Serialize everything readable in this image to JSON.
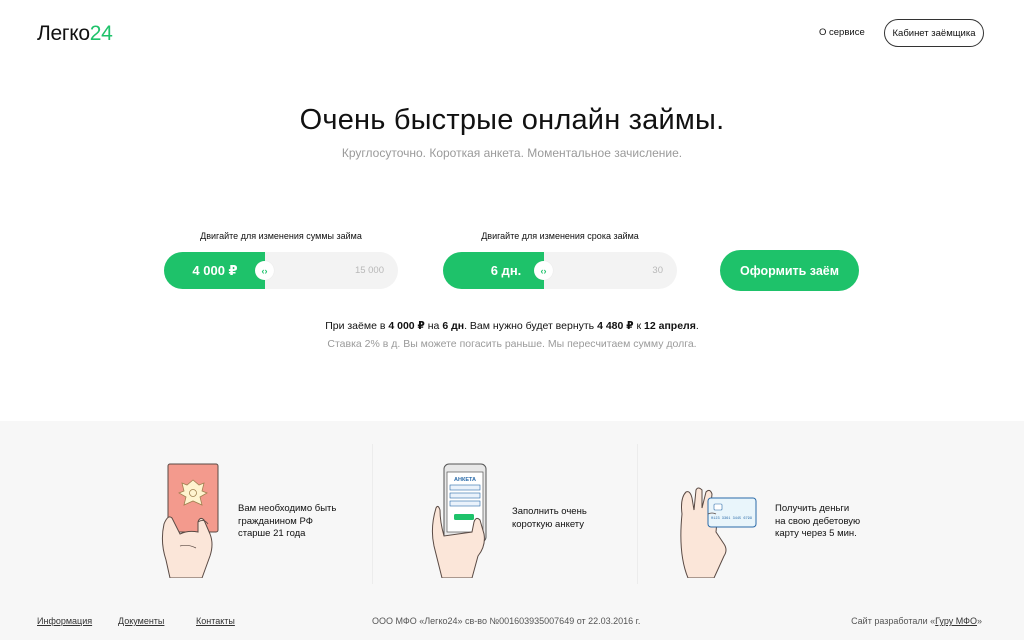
{
  "header": {
    "logo_text": "Легко",
    "logo_num": "24",
    "nav_about": "О сервисе",
    "cabinet_button": "Кабинет заёмщика"
  },
  "hero": {
    "title": "Очень быстрые онлайн займы.",
    "subtitle": "Круглосуточно. Короткая анкета. Моментальное зачисление."
  },
  "amount_slider": {
    "caption": "Двигайте для изменения суммы займа",
    "value_label": "4 000 ₽",
    "max_label": "15 000",
    "value": 4000,
    "max": 15000
  },
  "term_slider": {
    "caption": "Двигайте для изменения срока займа",
    "value_label": "6 дн.",
    "max_label": "30",
    "value": 6,
    "max": 30
  },
  "handle_glyph": "‹›",
  "apply_button": "Оформить заём",
  "summary": {
    "p1": "При заёме в ",
    "amount": "4 000 ₽",
    "p2": " на ",
    "days": "6 дн",
    "p3": ". Вам нужно будет вернуть ",
    "total": "4 480 ₽",
    "p4": " к ",
    "date": "12 апреля",
    "p5": ".",
    "note": "Ставка 2% в д. Вы можете погасить раньше. Мы пересчитаем сумму долга."
  },
  "steps": [
    {
      "icon": "passport-hand-icon",
      "text": [
        "Вам необходимо быть",
        "гражданином РФ",
        "старше 21 года"
      ]
    },
    {
      "icon": "phone-form-icon",
      "phone_label": "АНКЕТА",
      "text": [
        "Заполнить очень",
        "короткую анкету"
      ]
    },
    {
      "icon": "card-hand-icon",
      "card_number": "0123 3361 3445 6799",
      "text": [
        "Получить деньги",
        "на свою дебетовую",
        "карту через 5 мин."
      ]
    }
  ],
  "footer": {
    "links": [
      "Информация",
      "Документы",
      "Контакты"
    ],
    "legal": "ООО МФО «Легко24» св-во №001603935007649 от 22.03.2016 г.",
    "dev_prefix": "Сайт разработали «",
    "dev_link": "Гуру МФО",
    "dev_suffix": "»"
  },
  "colors": {
    "accent": "#1ec26a",
    "passport": "#f39a8d",
    "skin": "#fbe6d9"
  }
}
